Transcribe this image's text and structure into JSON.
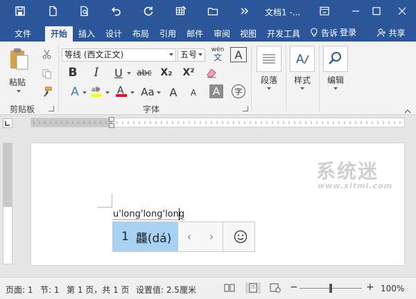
{
  "titlebar": {
    "title": "文档1 -..."
  },
  "tabs": [
    {
      "label": "文件"
    },
    {
      "label": "开始"
    },
    {
      "label": "插入"
    },
    {
      "label": "设计"
    },
    {
      "label": "布局"
    },
    {
      "label": "引用"
    },
    {
      "label": "邮件"
    },
    {
      "label": "审阅"
    },
    {
      "label": "视图"
    },
    {
      "label": "开发工具"
    }
  ],
  "tell_me": "告诉",
  "login": "登录",
  "share": "共享",
  "ribbon": {
    "clipboard": {
      "paste_label": "粘贴",
      "group_label": "剪贴板"
    },
    "font": {
      "font_name": "等线 (西文正文)",
      "font_size": "五号",
      "wen_top": "wén",
      "wen_bottom": "文",
      "group_label": "字体",
      "bold": "B",
      "italic": "I",
      "underline": "U",
      "strike": "abc",
      "subscript": "X₂",
      "superscript": "X²",
      "case": "Aa",
      "grow": "A",
      "shrink": "A",
      "charborder": "A",
      "enclose": "字"
    },
    "paragraph": {
      "label": "段落"
    },
    "styles": {
      "label": "样式"
    },
    "editing": {
      "label": "编辑"
    }
  },
  "document": {
    "typed_text": "u'long'long'long",
    "candidate_number": "1",
    "candidate_text": "龘(dá)",
    "prev_symbol": "‹",
    "next_symbol": "›"
  },
  "watermark": {
    "main": "系统迷",
    "sub": "www.xitmi.com"
  },
  "statusbar": {
    "page": "页面: 1",
    "section": "节: 1",
    "pages": "第 1 页，共 1 页",
    "setting": "设置值: 2.5厘米",
    "zoom_minus": "−",
    "zoom_plus": "+",
    "zoom": "100%"
  },
  "colors": {
    "brand": "#2b579a",
    "highlight": "#ffff00",
    "font_color": "#e81123",
    "candidate_bg": "#a7d2f4"
  },
  "zoom_level_fraction": 0.5
}
